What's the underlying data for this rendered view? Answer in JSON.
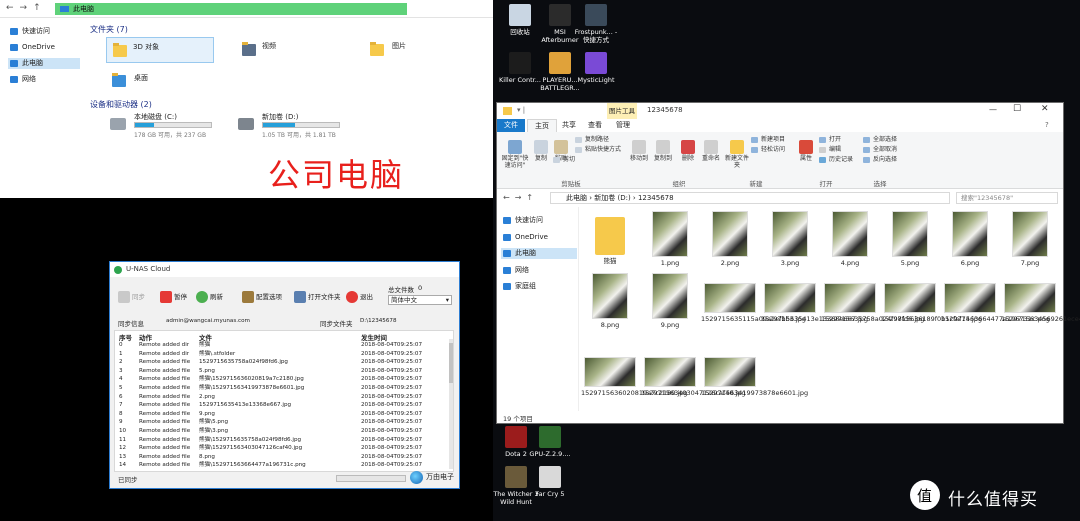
{
  "left_explorer": {
    "path": "此电脑",
    "nav": [
      {
        "label": "快速访问",
        "color": "#2a7fd6"
      },
      {
        "label": "OneDrive",
        "color": "#2a7fd6"
      },
      {
        "label": "此电脑",
        "color": "#2a7fd6",
        "selected": true
      },
      {
        "label": "网络",
        "color": "#2a7fd6"
      }
    ],
    "folders_header": "文件夹 (7)",
    "folders": [
      "3D 对象",
      "视频",
      "图片",
      "桌面"
    ],
    "drives_header": "设备和驱动器 (2)",
    "drives": [
      {
        "name": "本地磁盘 (C:)",
        "detail": "178 GB 可用，共 237 GB",
        "fill": 0.25
      },
      {
        "name": "新加卷 (D:)",
        "detail": "1.05 TB 可用，共 1.81 TB",
        "fill": 0.42
      }
    ],
    "caption": "公司电脑"
  },
  "desktop": {
    "icons_top": [
      {
        "label": "回收站",
        "color": "#c9d6e3"
      },
      {
        "label": "MSI Afterburner",
        "color": "#2b2b2b"
      },
      {
        "label": "Frostpunk... - 快捷方式",
        "color": "#3a4a5a"
      },
      {
        "label": "Killer Contr...",
        "color": "#1c1c1c"
      },
      {
        "label": "PLAYERU... BATTLEGR...",
        "color": "#e0a23a"
      },
      {
        "label": "MysticLight",
        "color": "#7a4ad6"
      }
    ],
    "icons_bottom": [
      {
        "label": "Dota 2",
        "color": "#9b1c1c"
      },
      {
        "label": "GPU-Z.2.9....",
        "color": "#2d6b2d"
      },
      {
        "label": "The Witcher 3 Wild Hunt",
        "color": "#6a5a3a"
      },
      {
        "label": "Far Cry 5",
        "color": "#d9d9d9"
      }
    ]
  },
  "right_explorer": {
    "title": "12345678",
    "context_tab": "图片工具",
    "tabs": [
      "文件",
      "主页",
      "共享",
      "查看",
      "管理"
    ],
    "ribbon": {
      "pin": "固定到\"快速访问\"",
      "copy": "复制",
      "paste": "粘贴",
      "copy_path": "复制路径",
      "paste_shortcut": "粘贴快捷方式",
      "cut": "剪切",
      "move_to": "移动到",
      "copy_to": "复制到",
      "delete": "删除",
      "rename": "重命名",
      "new_folder": "新建文件夹",
      "new_item": "新建项目",
      "easy_access": "轻松访问",
      "properties": "属性",
      "open": "打开",
      "edit": "编辑",
      "history": "历史记录",
      "select_all": "全部选择",
      "select_none": "全部取消",
      "invert": "反向选择",
      "groups": [
        "剪贴板",
        "组织",
        "新建",
        "打开",
        "选择"
      ]
    },
    "path": [
      "此电脑",
      "新加卷 (D:)",
      "12345678"
    ],
    "search_placeholder": "搜索\"12345678\"",
    "nav": [
      {
        "label": "快速访问"
      },
      {
        "label": "OneDrive"
      },
      {
        "label": "此电脑",
        "selected": true
      },
      {
        "label": "网络"
      },
      {
        "label": "家庭组"
      }
    ],
    "files": [
      "熊猫",
      "1.png",
      "2.png",
      "3.png",
      "4.png",
      "5.png",
      "6.png",
      "7.png",
      "8.png",
      "9.png",
      "1529715635115a09a2efbb3.jpg",
      "1529715635413e13368e667.jpg",
      "1529715635758a024f98fd6.jpg",
      "1529715636189f0b1cfaf74.jpg",
      "152971563664477a196731c.png",
      "1529715634569261ece4705.jpg",
      "1529715636020819a7c2180.jpg",
      "152971563403047126caf40.jpg",
      "152971563419973878e6601.jpg"
    ],
    "status": "19 个项目"
  },
  "unas": {
    "title": "U-NAS Cloud",
    "buttons": [
      "同步",
      "暂停",
      "刷新",
      "配置选项",
      "打开文件夹",
      "退出"
    ],
    "total_label": "总文件数",
    "total_value": "0",
    "lang": "简体中文",
    "sync_info_label": "同步信息",
    "account": "admin@wangcai.myunas.com",
    "sync_folder_label": "同步文件夹",
    "sync_folder": "D:\\12345678",
    "columns": [
      "序号",
      "动作",
      "文件",
      "发生时间"
    ],
    "rows": [
      [
        "0",
        "Remote added dir",
        "熊猫",
        "2018-08-04T09:25:07"
      ],
      [
        "1",
        "Remote added dir",
        "熊猫\\.stfolder",
        "2018-08-04T09:25:07"
      ],
      [
        "2",
        "Remote added file",
        "1529715635758a024f98fd6.jpg",
        "2018-08-04T09:25:07"
      ],
      [
        "3",
        "Remote added file",
        "5.png",
        "2018-08-04T09:25:07"
      ],
      [
        "4",
        "Remote added file",
        "熊猫\\1529715636020819a7c2180.jpg",
        "2018-08-04T09:25:07"
      ],
      [
        "5",
        "Remote added file",
        "熊猫\\152971563419973878e6601.jpg",
        "2018-08-04T09:25:07"
      ],
      [
        "6",
        "Remote added file",
        "2.png",
        "2018-08-04T09:25:07"
      ],
      [
        "7",
        "Remote added file",
        "1529715635413e13368e667.jpg",
        "2018-08-04T09:25:07"
      ],
      [
        "8",
        "Remote added file",
        "9.png",
        "2018-08-04T09:25:07"
      ],
      [
        "9",
        "Remote added file",
        "熊猫\\5.png",
        "2018-08-04T09:25:07"
      ],
      [
        "10",
        "Remote added file",
        "熊猫\\3.png",
        "2018-08-04T09:25:07"
      ],
      [
        "11",
        "Remote added file",
        "熊猫\\1529715635758a024f98fd6.jpg",
        "2018-08-04T09:25:07"
      ],
      [
        "12",
        "Remote added file",
        "熊猫\\152971563403047126caf40.jpg",
        "2018-08-04T09:25:07"
      ],
      [
        "13",
        "Remote added file",
        "8.png",
        "2018-08-04T09:25:07"
      ],
      [
        "14",
        "Remote added file",
        "熊猫\\152971563664477a196731c.png",
        "2018-08-04T09:25:07"
      ]
    ],
    "status": "已同步",
    "brand": "万由电子"
  },
  "watermark": "什么值得买"
}
